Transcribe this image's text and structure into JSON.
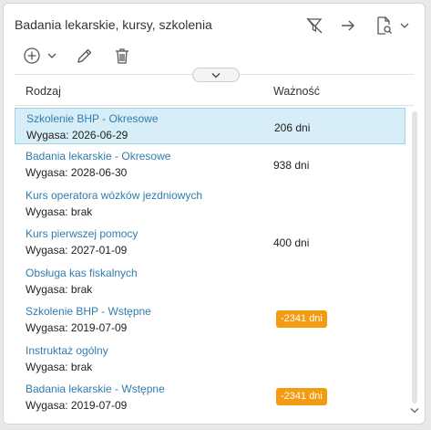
{
  "panel": {
    "title": "Badania lekarskie, kursy, szkolenia"
  },
  "icons": {
    "filter": "filter-off-icon",
    "arrow": "arrow-right-icon",
    "search_doc": "document-search-icon",
    "chevron": "chevron-down-icon",
    "add": "add-circle-icon",
    "add_dropdown": "chevron-down-icon",
    "edit": "pencil-icon",
    "delete": "trash-icon",
    "collapse": "chevron-down-icon"
  },
  "table": {
    "columns": [
      "Rodzaj",
      "Ważność"
    ],
    "rows": [
      {
        "name": "Szkolenie BHP - Okresowe",
        "expiry": "Wygasa: 2026-06-29",
        "validity": "206 dni",
        "warning": false,
        "selected": true
      },
      {
        "name": "Badania lekarskie - Okresowe",
        "expiry": "Wygasa: 2028-06-30",
        "validity": "938 dni",
        "warning": false,
        "selected": false
      },
      {
        "name": "Kurs operatora wózków jezdniowych",
        "expiry": "Wygasa: brak",
        "validity": "",
        "warning": false,
        "selected": false
      },
      {
        "name": "Kurs pierwszej pomocy",
        "expiry": "Wygasa: 2027-01-09",
        "validity": "400 dni",
        "warning": false,
        "selected": false
      },
      {
        "name": "Obsługa kas fiskalnych",
        "expiry": "Wygasa: brak",
        "validity": "",
        "warning": false,
        "selected": false
      },
      {
        "name": "Szkolenie BHP - Wstępne",
        "expiry": "Wygasa: 2019-07-09",
        "validity": "-2341 dni",
        "warning": true,
        "selected": false
      },
      {
        "name": "Instruktaż ogólny",
        "expiry": "Wygasa: brak",
        "validity": "",
        "warning": false,
        "selected": false
      },
      {
        "name": "Badania lekarskie - Wstępne",
        "expiry": "Wygasa: 2019-07-09",
        "validity": "-2341 dni",
        "warning": true,
        "selected": false
      }
    ]
  },
  "colors": {
    "link": "#2f7cb0",
    "selected_bg": "#d7eef8",
    "warning": "#f39c12"
  }
}
